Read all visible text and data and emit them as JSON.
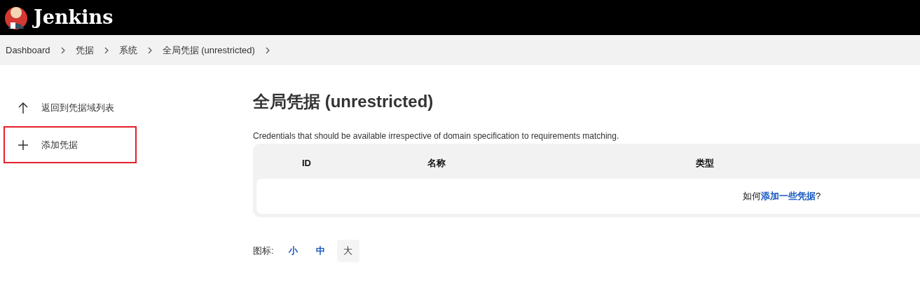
{
  "header": {
    "title": "Jenkins"
  },
  "breadcrumbs": [
    "Dashboard",
    "凭据",
    "系统",
    "全局凭据 (unrestricted)"
  ],
  "sidebar": {
    "items": [
      {
        "kind": "back",
        "label": "返回到凭据域列表",
        "highlighted": false
      },
      {
        "kind": "add",
        "label": "添加凭据",
        "highlighted": true
      }
    ]
  },
  "main": {
    "title": "全局凭据 (unrestricted)",
    "description": "Credentials that should be available irrespective of domain specification to requirements matching.",
    "table": {
      "columns": [
        "ID",
        "名称",
        "类型"
      ],
      "empty_prefix": "如何",
      "empty_link": "添加一些凭据",
      "empty_suffix": "?"
    },
    "icon_size": {
      "label": "图标:",
      "options": [
        {
          "label": "小",
          "selected": false
        },
        {
          "label": "中",
          "selected": false
        },
        {
          "label": "大",
          "selected": true
        }
      ]
    }
  }
}
